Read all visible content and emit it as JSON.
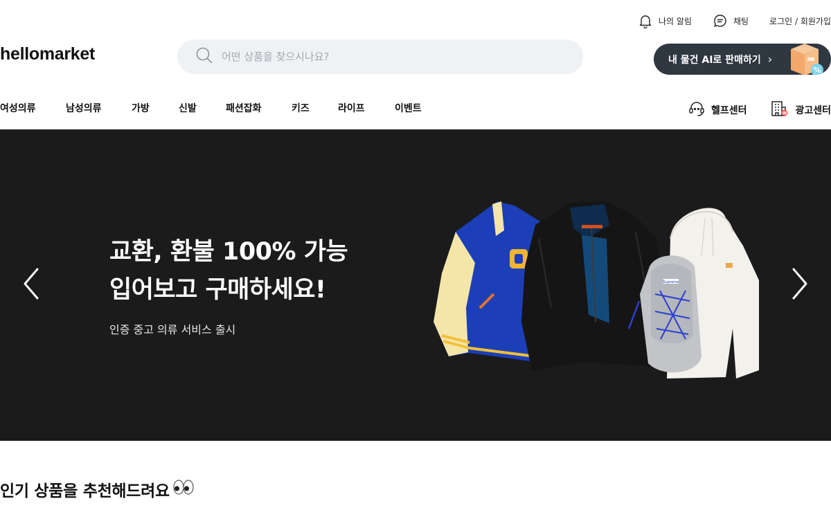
{
  "utility": {
    "notifications": "나의 알림",
    "chat": "채팅",
    "login": "로그인 / 회원가입"
  },
  "header": {
    "logo": "hellomarket",
    "search_placeholder": "어떤 상품을 찾으시나요?",
    "ai_sell_label": "내 물건 AI로 판매하기",
    "ai_sell_chevron": "›"
  },
  "nav": {
    "categories": [
      "여성의류",
      "남성의류",
      "가방",
      "신발",
      "패션잡화",
      "키즈",
      "라이프",
      "이벤트"
    ],
    "help_center": "헬프센터",
    "ad_center": "광고센터"
  },
  "banner": {
    "title_line1": "교환, 환불 100% 가능",
    "title_line2": "입어보고 구매하세요!",
    "subtitle": "인증 중고 의류 서비스 출시"
  },
  "section": {
    "title": "인기 상품을 추천해드려요",
    "emoji": "👀"
  },
  "colors": {
    "banner_bg": "#1b1b1c",
    "search_bg": "#eff2f5",
    "ai_button_bg": "#2f3741",
    "badge_red": "#ff5a5a"
  },
  "icons": [
    "bell-icon",
    "chat-icon",
    "search-icon",
    "headset-icon",
    "building-icon",
    "chevron-left-icon",
    "chevron-right-icon"
  ]
}
